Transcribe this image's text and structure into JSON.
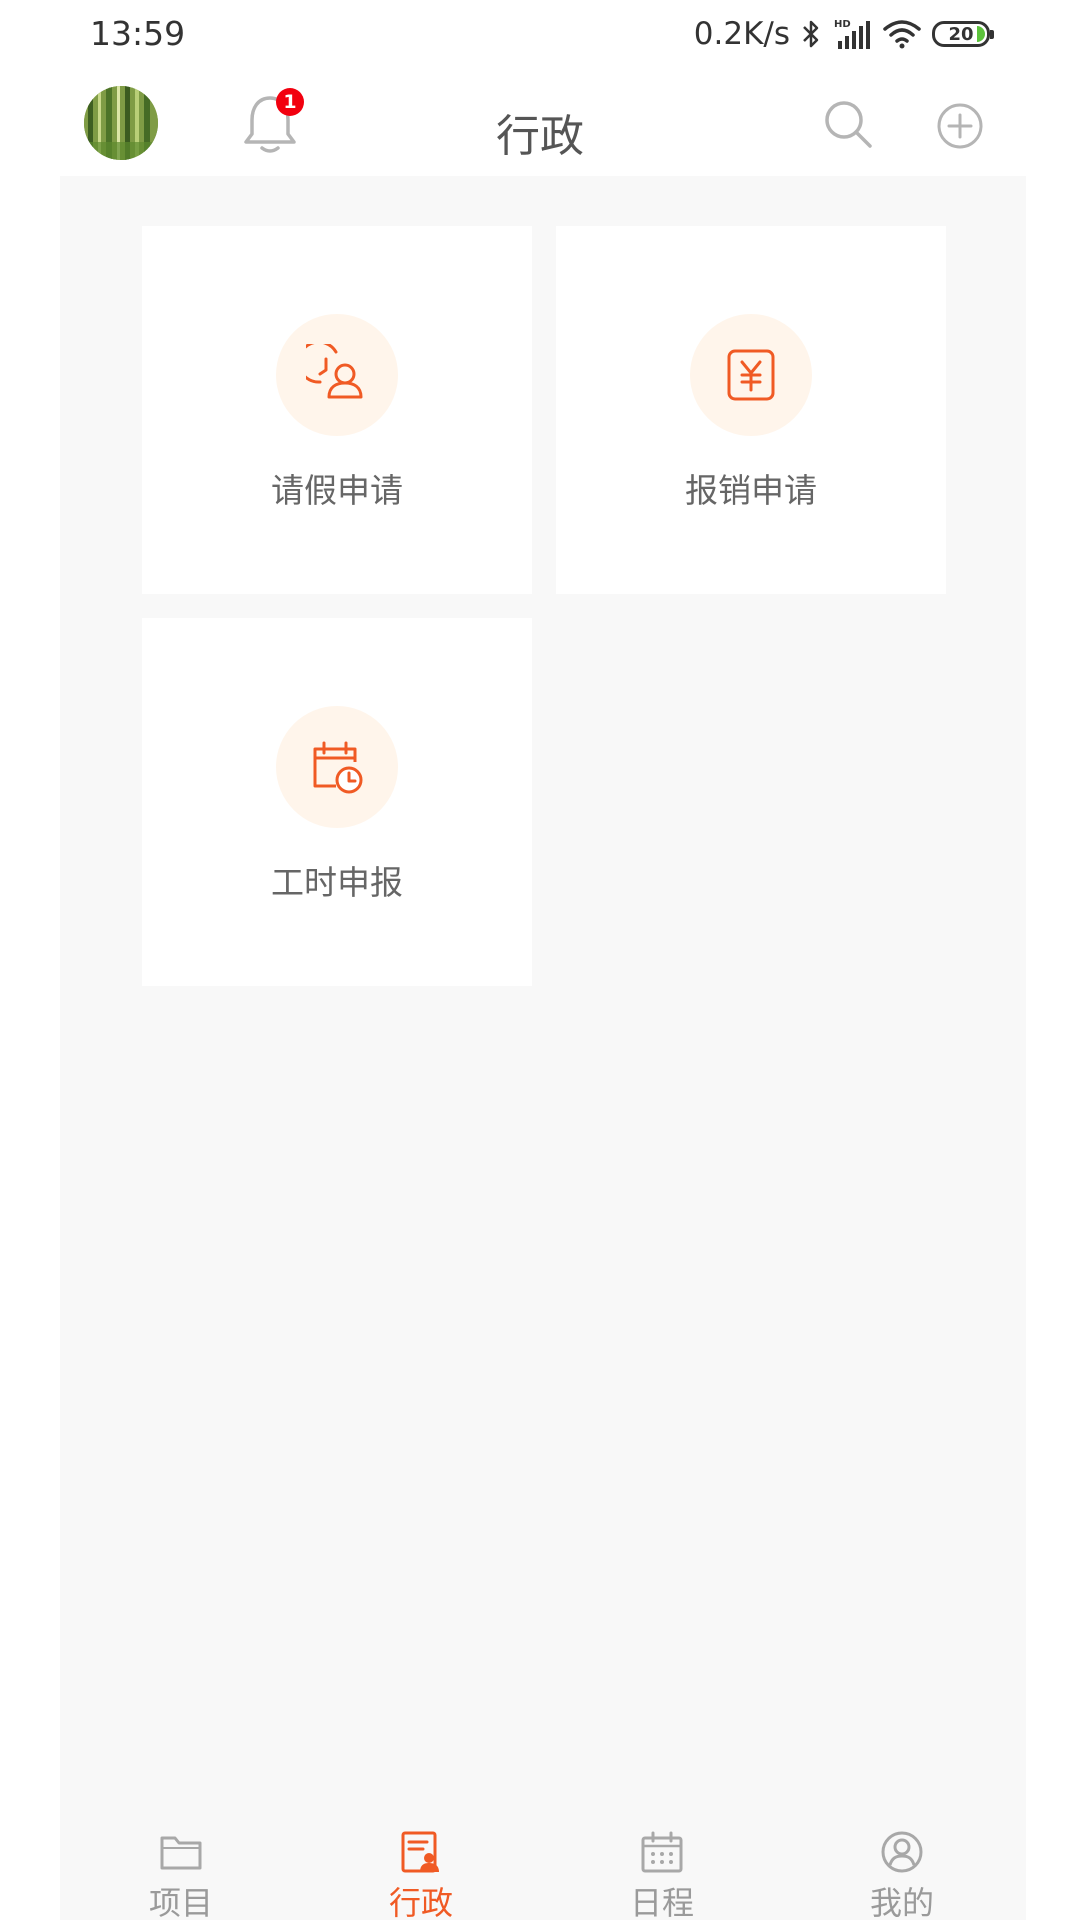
{
  "status_bar": {
    "time": "13:59",
    "net_speed": "0.2K/s",
    "battery": "20",
    "icons": [
      "bluetooth-icon",
      "signal-hd-icon",
      "wifi-icon",
      "battery-icon"
    ]
  },
  "header": {
    "title": "行政",
    "notification_count": "1",
    "icons": [
      "avatar",
      "bell-icon",
      "search-icon",
      "add-circle-icon"
    ]
  },
  "cards": [
    {
      "label": "请假申请",
      "icon": "leave-request-icon"
    },
    {
      "label": "报销申请",
      "icon": "reimbursement-icon"
    },
    {
      "label": "工时申报",
      "icon": "timesheet-icon"
    }
  ],
  "bottom_nav": {
    "items": [
      {
        "label": "项目",
        "icon": "folder-icon",
        "active": false
      },
      {
        "label": "行政",
        "icon": "admin-icon",
        "active": true
      },
      {
        "label": "日程",
        "icon": "calendar-icon",
        "active": false
      },
      {
        "label": "我的",
        "icon": "profile-icon",
        "active": false
      }
    ]
  },
  "colors": {
    "accent": "#f05a24",
    "badge": "#f2000f",
    "icon_bg": "#fff5eb",
    "page_bg": "#f8f8f8",
    "inactive": "#9a9a9a"
  }
}
